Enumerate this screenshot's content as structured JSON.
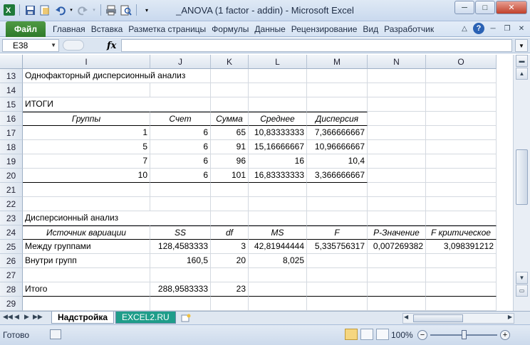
{
  "window": {
    "title": "_ANOVA (1 factor - addin)  -  Microsoft Excel",
    "buttons": {
      "minimize": "─",
      "maximize": "□",
      "close": "✕"
    }
  },
  "ribbon": {
    "file_tab": "Файл",
    "tabs": [
      "Главная",
      "Вставка",
      "Разметка страницы",
      "Формулы",
      "Данные",
      "Рецензирование",
      "Вид",
      "Разработчик"
    ],
    "help": "?"
  },
  "formula_bar": {
    "name_box": "E38",
    "fx": "fx",
    "content": ""
  },
  "columns": [
    "I",
    "J",
    "K",
    "L",
    "M",
    "N",
    "O"
  ],
  "rows": [
    {
      "num": "13",
      "cells": [
        "Однофакторный дисперсионный анализ",
        "",
        "",
        "",
        "",
        "",
        ""
      ]
    },
    {
      "num": "14",
      "cells": [
        "",
        "",
        "",
        "",
        "",
        "",
        ""
      ]
    },
    {
      "num": "15",
      "cells": [
        "ИТОГИ",
        "",
        "",
        "",
        "",
        "",
        ""
      ]
    },
    {
      "num": "16",
      "cells": [
        "Группы",
        "Счет",
        "Сумма",
        "Среднее",
        "Дисперсия",
        "",
        ""
      ]
    },
    {
      "num": "17",
      "cells": [
        "1",
        "6",
        "65",
        "10,83333333",
        "7,366666667",
        "",
        ""
      ]
    },
    {
      "num": "18",
      "cells": [
        "5",
        "6",
        "91",
        "15,16666667",
        "10,96666667",
        "",
        ""
      ]
    },
    {
      "num": "19",
      "cells": [
        "7",
        "6",
        "96",
        "16",
        "10,4",
        "",
        ""
      ]
    },
    {
      "num": "20",
      "cells": [
        "10",
        "6",
        "101",
        "16,83333333",
        "3,366666667",
        "",
        ""
      ]
    },
    {
      "num": "21",
      "cells": [
        "",
        "",
        "",
        "",
        "",
        "",
        ""
      ]
    },
    {
      "num": "22",
      "cells": [
        "",
        "",
        "",
        "",
        "",
        "",
        ""
      ]
    },
    {
      "num": "23",
      "cells": [
        "Дисперсионный анализ",
        "",
        "",
        "",
        "",
        "",
        ""
      ]
    },
    {
      "num": "24",
      "cells": [
        "Источник вариации",
        "SS",
        "df",
        "MS",
        "F",
        "P-Значение",
        "F критическое"
      ]
    },
    {
      "num": "25",
      "cells": [
        "Между группами",
        "128,4583333",
        "3",
        "42,81944444",
        "5,335756317",
        "0,007269382",
        "3,098391212"
      ]
    },
    {
      "num": "26",
      "cells": [
        "Внутри групп",
        "160,5",
        "20",
        "8,025",
        "",
        "",
        ""
      ]
    },
    {
      "num": "27",
      "cells": [
        "",
        "",
        "",
        "",
        "",
        "",
        ""
      ]
    },
    {
      "num": "28",
      "cells": [
        "Итого",
        "288,9583333",
        "23",
        "",
        "",
        "",
        ""
      ]
    },
    {
      "num": "29",
      "cells": [
        "",
        "",
        "",
        "",
        "",
        "",
        ""
      ]
    }
  ],
  "sheet_tabs": [
    "Надстройка",
    "EXCEL2.RU"
  ],
  "status": {
    "ready": "Готово",
    "zoom": "100%"
  }
}
